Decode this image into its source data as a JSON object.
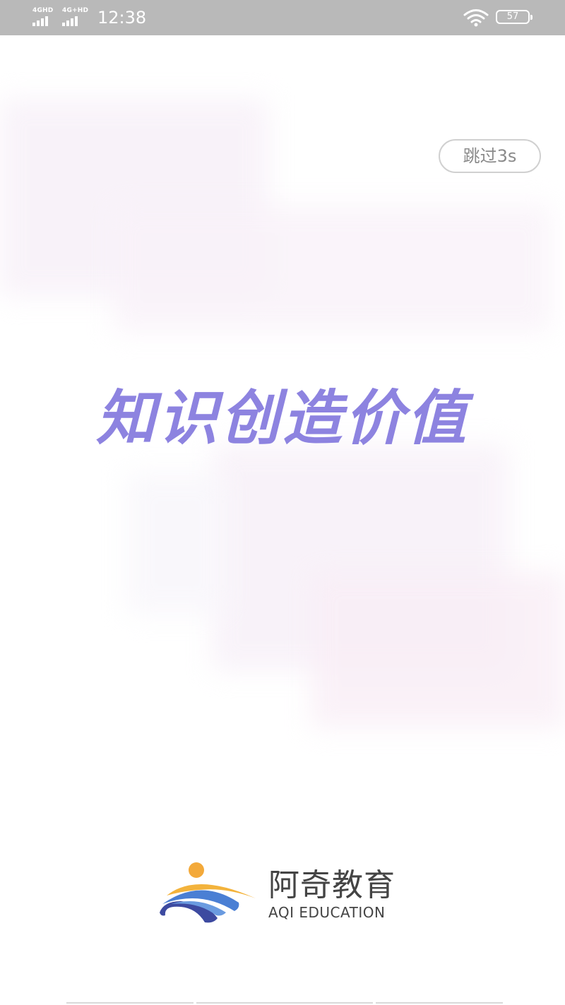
{
  "status_bar": {
    "network_1": "4GHD",
    "network_2": "4G+HD",
    "time": "12:38",
    "battery": "57",
    "wifi_icon": "wifi-icon"
  },
  "splash": {
    "skip_label": "跳过3s",
    "slogan": "知识创造价值"
  },
  "brand": {
    "name_cn": "阿奇教育",
    "name_en": "AQI EDUCATION",
    "logo_icon": "aqi-education-logo-icon",
    "colors": {
      "sun": "#f3a93a",
      "wave_yellow": "#f3b33c",
      "wave_blue": "#4a7fd4",
      "wave_navy": "#3d4aa0",
      "slogan": "#8d83e0"
    }
  }
}
